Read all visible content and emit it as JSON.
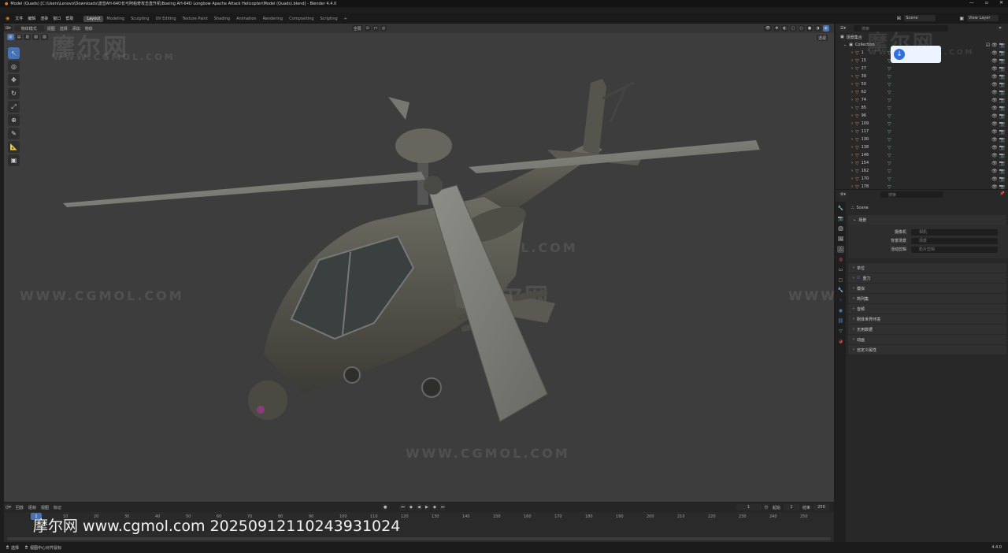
{
  "window": {
    "title": "Model (Quads) [C:\\Users\\Lenovo\\Downloads\\波音AH-64D长弓阿帕奇攻击直升机\\Boeing AH-64D Longbow Apache Attack Helicopter\\Model (Quads).blend] - Blender 4.4.0"
  },
  "menu": {
    "items": [
      "文件",
      "编辑",
      "渲染",
      "窗口",
      "帮助"
    ],
    "workspaces": [
      "Layout",
      "Modeling",
      "Sculpting",
      "UV Editing",
      "Texture Paint",
      "Shading",
      "Animation",
      "Rendering",
      "Compositing",
      "Scripting"
    ],
    "add_tab": "+",
    "scene_name": "Scene",
    "view_layer": "View Layer"
  },
  "viewport": {
    "mode": "物体模式",
    "menus": [
      "视图",
      "选择",
      "添加",
      "物体"
    ],
    "transform": "全局",
    "view_label": "透视",
    "watermarks": [
      "摩尔网",
      "WWW.CGMOL.COM",
      "WWW.CGMOL.COM",
      "WWW.CGMOL.COM",
      "摩尔网",
      "WWW.CGMOL.COM",
      "WWW.CGMOL.COM"
    ]
  },
  "timeline": {
    "menus": [
      "回放",
      "抠帧",
      "视图",
      "标记"
    ],
    "current_frame": "1",
    "start_label": "起始",
    "start": "1",
    "end_label": "结束",
    "end": "250",
    "ticks": [
      "10",
      "20",
      "30",
      "40",
      "50",
      "60",
      "70",
      "80",
      "90",
      "100",
      "110",
      "120",
      "130",
      "140",
      "150",
      "160",
      "170",
      "180",
      "190",
      "200",
      "210",
      "220",
      "230",
      "240",
      "250"
    ]
  },
  "overlay": {
    "text": "摩尔网 www.cgmol.com 20250912110243931024"
  },
  "status": {
    "select": "选择",
    "center": "视图中心对齐鼠标",
    "version": "4.4.0"
  },
  "outliner": {
    "search_placeholder": "搜索",
    "scene_collection": "场景集合",
    "collection": "Collection",
    "rows": [
      "1",
      "15",
      "27",
      "39",
      "50",
      "62",
      "74",
      "85",
      "96",
      "109",
      "117",
      "130",
      "138",
      "146",
      "154",
      "162",
      "170",
      "178"
    ],
    "watermark": "摩尔网",
    "watermark_url": "WWW.CGMOL.COM"
  },
  "properties": {
    "search_placeholder": "搜索",
    "scene": "Scene",
    "section_scene": "场景",
    "camera_label": "摄像机",
    "camera_value": "相机",
    "background_label": "背景场景",
    "background_value": "场景",
    "clip_label": "活动剪辑",
    "clip_value": "影片剪辑",
    "panels": [
      "单位",
      "重力",
      "模拟",
      "简列集",
      "音频",
      "刚体世界环境",
      "无用数据",
      "动画",
      "自定义属性"
    ]
  },
  "colors": {
    "accent": "#4772b3",
    "vertex_orange": "#e08a3a",
    "mesh_green": "#59c29a"
  }
}
